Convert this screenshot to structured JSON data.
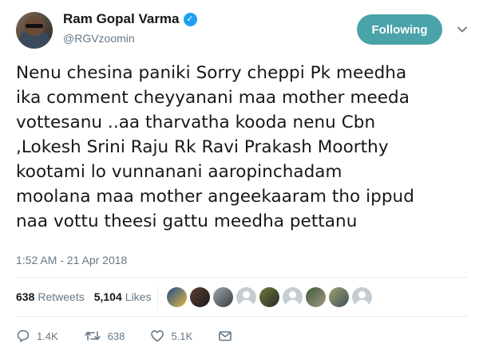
{
  "author": {
    "display_name": "Ram Gopal Varma",
    "handle": "@RGVzoomin",
    "verified_icon": "verified-badge-icon",
    "avatar_icon": "profile-photo"
  },
  "follow_button": {
    "label": "Following",
    "color": "#4aa3a8"
  },
  "menu_icon": "chevron-down-icon",
  "tweet": {
    "text": "Nenu chesina paniki Sorry cheppi Pk meedha\nika comment cheyyanani maa mother meeda\nvottesanu ..aa tharvatha kooda nenu Cbn\n,Lokesh Srini Raju Rk Ravi Prakash Moorthy\nkootami lo vunnanani aaropinchadam\nmoolana maa mother angeekaaram tho ippud\nnaa vottu theesi gattu meedha pettanu",
    "timestamp": "1:52 AM - 21 Apr 2018"
  },
  "stats": {
    "retweets_count": "638",
    "retweets_label": "Retweets",
    "likes_count": "5,104",
    "likes_label": "Likes"
  },
  "likers": [
    "photo",
    "photo",
    "photo",
    "default",
    "photo",
    "default",
    "photo",
    "photo",
    "default"
  ],
  "actions": {
    "reply_count": "1.4K",
    "retweet_count": "638",
    "like_count": "5.1K"
  },
  "colors": {
    "text": "#14171a",
    "secondary": "#657786",
    "verified": "#1da1f2",
    "divider": "#e6ecf0"
  }
}
